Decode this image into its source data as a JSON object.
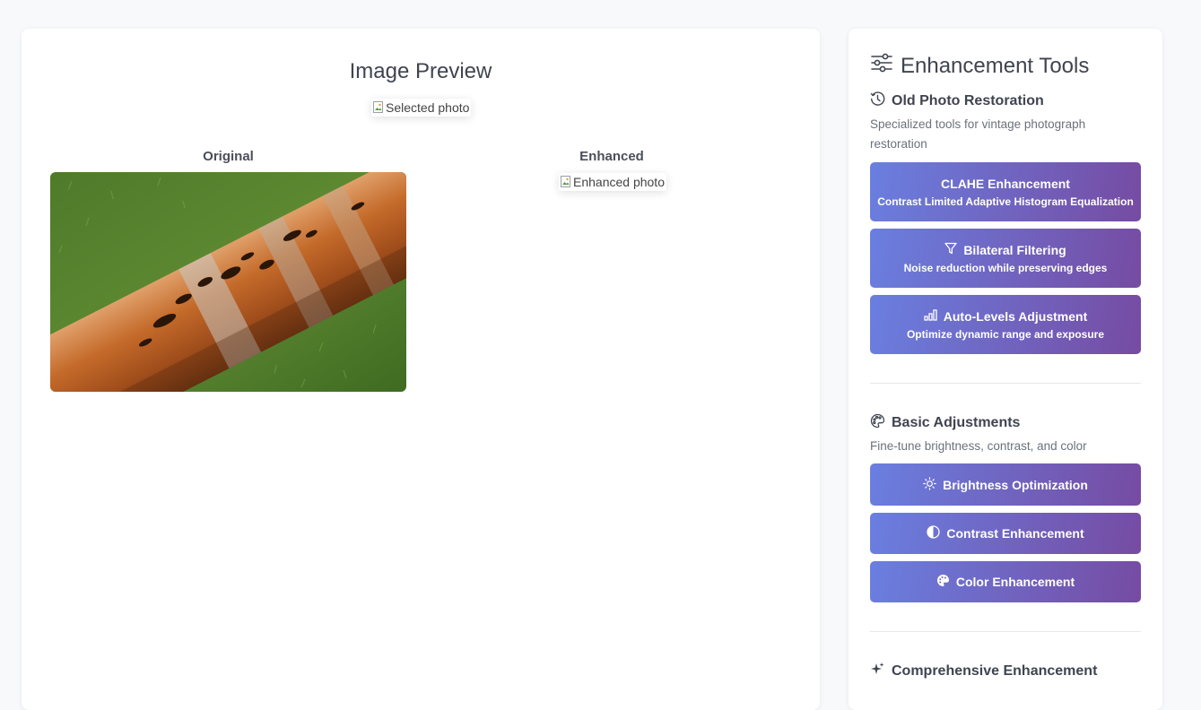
{
  "preview": {
    "title": "Image Preview",
    "selected_alt": "Selected photo",
    "original_label": "Original",
    "enhanced_label": "Enhanced",
    "enhanced_alt": "Enhanced photo"
  },
  "tools": {
    "title": "Enhancement Tools",
    "title_icon": "sliders-icon",
    "sections": [
      {
        "title": "Old Photo Restoration",
        "icon": "history-icon",
        "description": "Specialized tools for vintage photograph restoration",
        "buttons": [
          {
            "label": "CLAHE Enhancement",
            "sub": "Contrast Limited Adaptive Histogram Equalization",
            "icon": ""
          },
          {
            "label": "Bilateral Filtering",
            "sub": "Noise reduction while preserving edges",
            "icon": "filter-icon"
          },
          {
            "label": "Auto-Levels Adjustment",
            "sub": "Optimize dynamic range and exposure",
            "icon": "bar-chart-icon"
          }
        ]
      },
      {
        "title": "Basic Adjustments",
        "icon": "palette-icon",
        "description": "Fine-tune brightness, contrast, and color",
        "buttons": [
          {
            "label": "Brightness Optimization",
            "icon": "sun-icon"
          },
          {
            "label": "Contrast Enhancement",
            "icon": "contrast-icon"
          },
          {
            "label": "Color Enhancement",
            "icon": "palette-fill-icon"
          }
        ]
      },
      {
        "title": "Comprehensive Enhancement",
        "icon": "sparkles-icon"
      }
    ]
  },
  "colors": {
    "button_gradient_start": "#6a7fe0",
    "button_gradient_end": "#764ba2",
    "background": "#f8f9fb"
  }
}
